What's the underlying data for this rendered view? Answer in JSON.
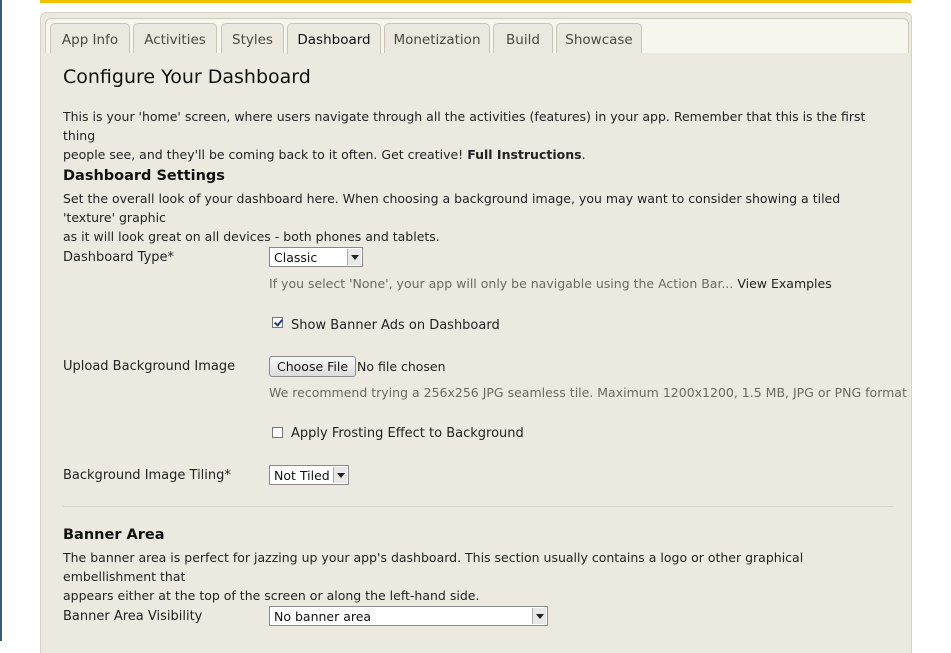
{
  "tabs": [
    {
      "label": "App Info"
    },
    {
      "label": "Activities"
    },
    {
      "label": "Styles"
    },
    {
      "label": "Dashboard"
    },
    {
      "label": "Monetization"
    },
    {
      "label": "Build"
    },
    {
      "label": "Showcase"
    }
  ],
  "page": {
    "title": "Configure Your Dashboard",
    "intro_line1": "This is your 'home' screen, where users navigate through all the activities (features) in your app. Remember that this is the first thing",
    "intro_line2": "people see, and they'll be coming back to it often. Get creative!",
    "full_instructions_link": "Full Instructions",
    "period": "."
  },
  "dashboard_settings": {
    "heading": "Dashboard Settings",
    "desc_line1": "Set the overall look of your dashboard here. When choosing a background image, you may want to consider showing a tiled 'texture' graphic",
    "desc_line2": "as it will look great on all devices - both phones and tablets.",
    "type_label": "Dashboard Type*",
    "type_value": "Classic",
    "type_hint": "If you select 'None', your app will only be navigable using the Action Bar...",
    "view_examples": "View Examples",
    "banner_ads_label": "Show Banner Ads on Dashboard",
    "banner_ads_checked": true,
    "upload_label": "Upload Background Image",
    "choose_file": "Choose File",
    "no_file": "No file chosen",
    "upload_hint": "We recommend trying a 256x256 JPG seamless tile. Maximum 1200x1200, 1.5 MB, JPG or PNG format",
    "frosting_label": "Apply Frosting Effect to Background",
    "frosting_checked": false,
    "tiling_label": "Background Image Tiling*",
    "tiling_value": "Not Tiled"
  },
  "banner_area": {
    "heading": "Banner Area",
    "desc_line1": "The banner area is perfect for jazzing up your app's dashboard. This section usually contains a logo or other graphical embellishment that",
    "desc_line2": "appears either at the top of the screen or along the left-hand side.",
    "visibility_label": "Banner Area Visibility",
    "visibility_value": "No banner area"
  }
}
